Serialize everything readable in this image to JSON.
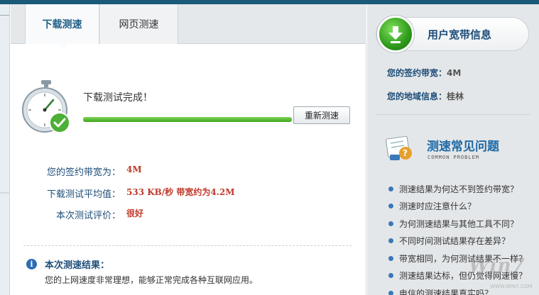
{
  "tabs": [
    {
      "label": "下载测速"
    },
    {
      "label": "网页测速"
    }
  ],
  "test": {
    "status": "下载测试完成！",
    "progress_percent": 100,
    "retest_label": "重新测速"
  },
  "results": {
    "bandwidth_label": "您的签约带宽为：",
    "bandwidth_value": "4M",
    "avg_label": "下载测试平均值：",
    "avg_value": "533 KB/秒  带宽约为4.2M",
    "rating_label": "本次测试评价：",
    "rating_value": "很好"
  },
  "evaluation": {
    "title": "本次测速结果：",
    "text": "您的上网速度非常理想，能够正常完成各种互联网应用。"
  },
  "sidebar": {
    "title": "用户宽带信息",
    "bandwidth_label": "您的签约带宽：",
    "bandwidth_value": "4M",
    "region_label": "您的地域信息：",
    "region_value": "桂林"
  },
  "faq": {
    "title": "测速常见问题",
    "subtitle": "COMMON PROBLEM",
    "items": [
      "测速结果为何达不到签约带宽？",
      "测速时应注意什么？",
      "为何测速结果与其他工具不同？",
      "不同时间测试结果存在差异？",
      "带宽相同，为何测试结果不一样？",
      "测速结果达标，但仍觉得网速慢？",
      "电信的测速结果真实吗？"
    ]
  },
  "watermark": "Win7",
  "watermark_sub": "WWW.WIN7.COM",
  "colors": {
    "accent": "#1e4e79",
    "value_red": "#c0392b",
    "progress_green": "#3ea81c"
  },
  "icons": [
    "stopwatch-icon",
    "download-arrow-icon",
    "info-icon",
    "faq-icon"
  ]
}
